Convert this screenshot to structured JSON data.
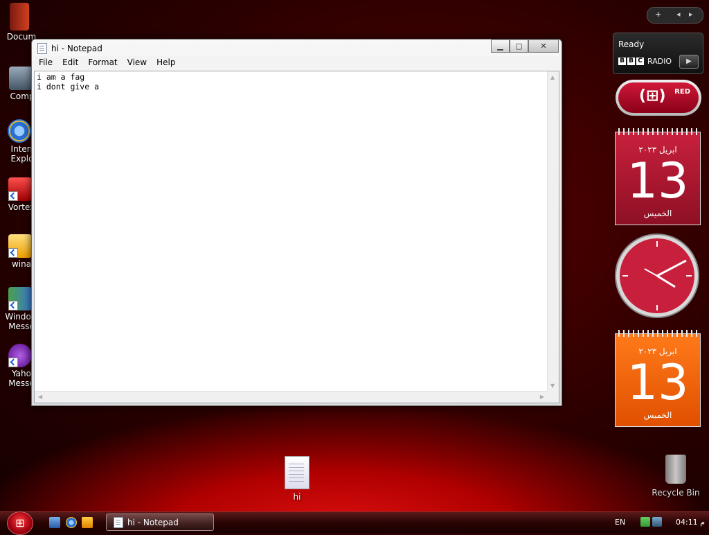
{
  "desktop_icons": [
    {
      "label": "Docum",
      "icon": "documents-folder-icon"
    },
    {
      "label": "Comp",
      "icon": "computer-icon"
    },
    {
      "label": "Interr\nExplo",
      "icon": "internet-explorer-icon"
    },
    {
      "label": "Vortex",
      "icon": "vortex-icon"
    },
    {
      "label": "wina",
      "icon": "winamp-icon"
    },
    {
      "label": "Window\nMesse",
      "icon": "windows-messenger-icon"
    },
    {
      "label": "Yaho\nMesse",
      "icon": "yahoo-messenger-icon"
    }
  ],
  "notepad": {
    "title": "hi - Notepad",
    "menu": [
      "File",
      "Edit",
      "Format",
      "View",
      "Help"
    ],
    "content": "i am a fag\ni dont give a "
  },
  "gadgets": {
    "radio": {
      "status": "Ready",
      "brand": [
        "B",
        "B",
        "C"
      ],
      "name": "RADIO"
    },
    "red": {
      "label": "RED"
    },
    "calendar1": {
      "month": "ابريل ٢٠٢٣",
      "day": "13",
      "weekday": "الخميس"
    },
    "calendar2": {
      "month": "ابريل ٢٠٢٣",
      "day": "13",
      "weekday": "الخميس"
    },
    "sidebar_controls": {
      "add": "+",
      "prev": "◂",
      "next": "▸"
    }
  },
  "desktop_files": {
    "hi": "hi",
    "recycle_bin": "Recycle Bin"
  },
  "taskbar": {
    "active_window": "hi - Notepad",
    "language": "EN",
    "time": "04:11 م"
  },
  "colors": {
    "desktop_red": "#b00000",
    "calendar_red": "#c8203c",
    "calendar_orange": "#ff7a1a",
    "clock_red": "#c8203c"
  }
}
